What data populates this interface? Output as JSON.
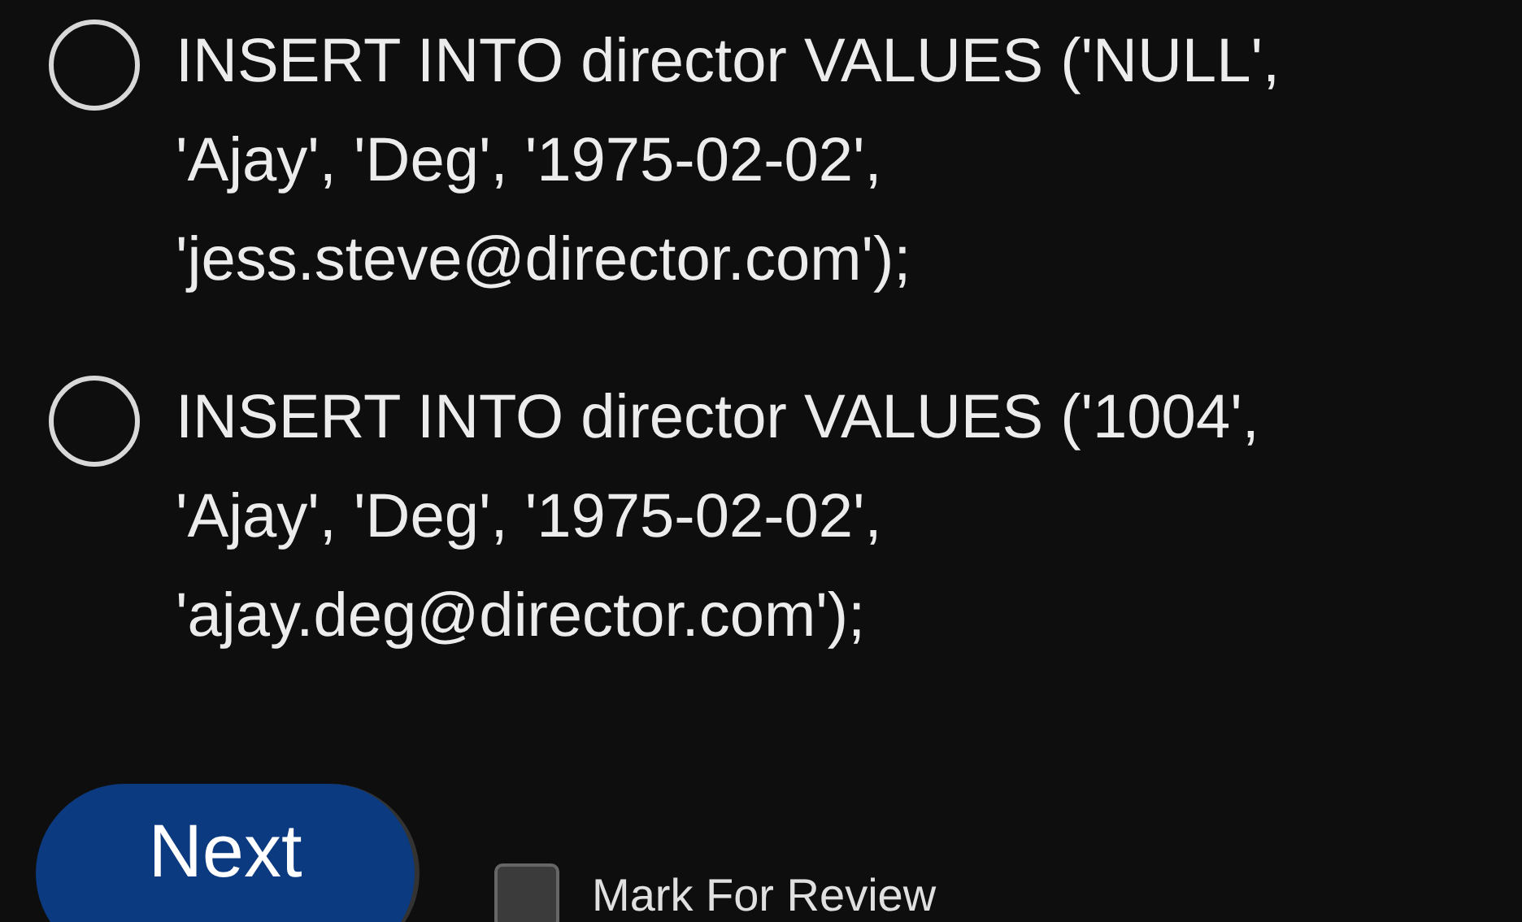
{
  "options": [
    {
      "text": "INSERT INTO director VALUES ('NULL', 'Ajay', 'Deg', '1975-02-02', 'jess.steve@director.com');",
      "selected": false
    },
    {
      "text": "INSERT INTO director VALUES ('1004', 'Ajay', 'Deg', '1975-02-02', 'ajay.deg@director.com');",
      "selected": false
    }
  ],
  "next_button": "Next",
  "review": {
    "label": "Mark For Review",
    "checked": false
  }
}
